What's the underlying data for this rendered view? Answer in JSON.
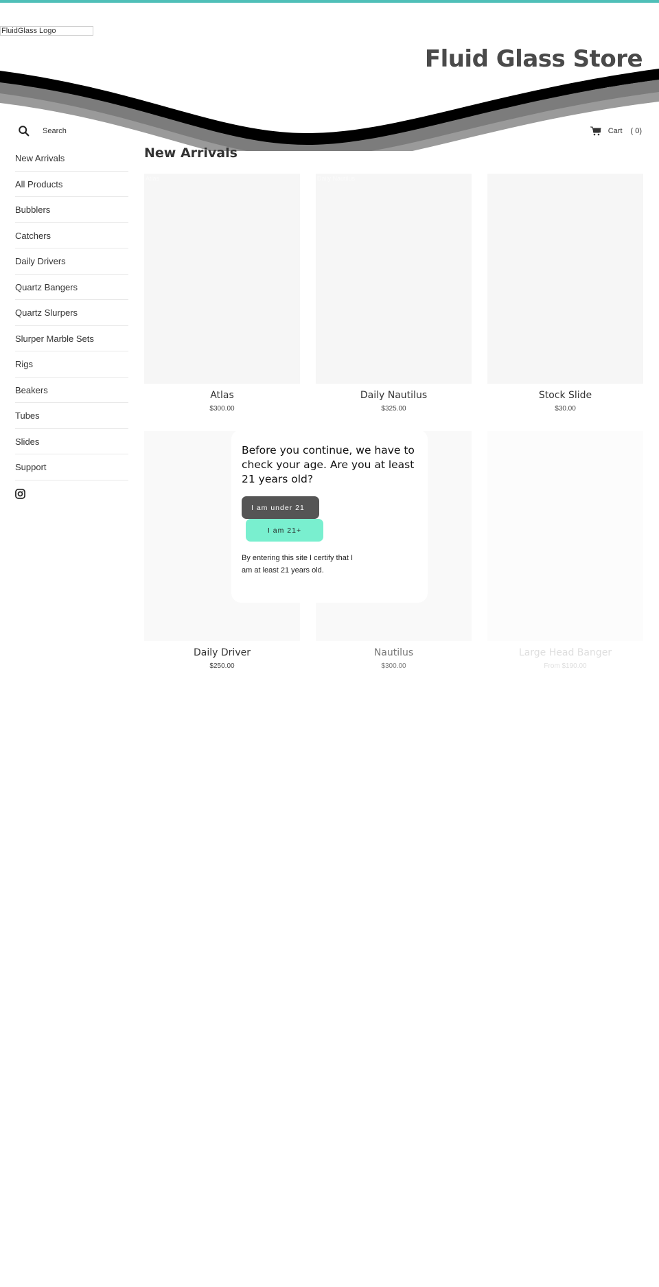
{
  "header": {
    "logo_alt": "FluidGlass Logo",
    "store_title": "Fluid Glass Store",
    "accent_color": "#4fbfb8",
    "search_label": "Search",
    "search_icon": "search-icon",
    "cart_icon": "cart-icon",
    "cart_label": "Cart",
    "cart_count": "( 0)"
  },
  "sidebar": {
    "items": [
      {
        "label": "New Arrivals"
      },
      {
        "label": "All Products"
      },
      {
        "label": "Bubblers"
      },
      {
        "label": "Catchers"
      },
      {
        "label": "Daily Drivers"
      },
      {
        "label": "Quartz Bangers"
      },
      {
        "label": "Quartz Slurpers"
      },
      {
        "label": "Slurper Marble Sets"
      },
      {
        "label": "Rigs"
      },
      {
        "label": "Beakers"
      },
      {
        "label": "Tubes"
      },
      {
        "label": "Slides"
      },
      {
        "label": "Support"
      }
    ],
    "social_icon": "instagram-icon"
  },
  "main": {
    "title": "New Arrivals",
    "products": [
      {
        "name": "Atlas",
        "price": "$300.00",
        "image_alt": "Atlas"
      },
      {
        "name": "Daily Nautilus",
        "price": "$325.00",
        "image_alt": "Daily Nautilus"
      },
      {
        "name": "Stock Slide",
        "price": "$30.00",
        "image_alt": "Stock Slide"
      },
      {
        "name": "Daily Driver",
        "price": "$250.00",
        "image_alt": "Daily Driver"
      },
      {
        "name": "Nautilus",
        "price": "$300.00",
        "image_alt": "Nautilus"
      },
      {
        "name": "Large Head Banger",
        "price": "From $190.00",
        "image_alt": "Large Head Banger"
      }
    ]
  },
  "age_gate": {
    "question": "Before you continue, we have to check your age. Are you at least 21 years old?",
    "under_label": "I am under 21",
    "over_label": "I am 21+",
    "note": "By entering this site I certify that I am at least 21 years old.",
    "under_color": "#555555",
    "over_color": "#79efcf"
  }
}
